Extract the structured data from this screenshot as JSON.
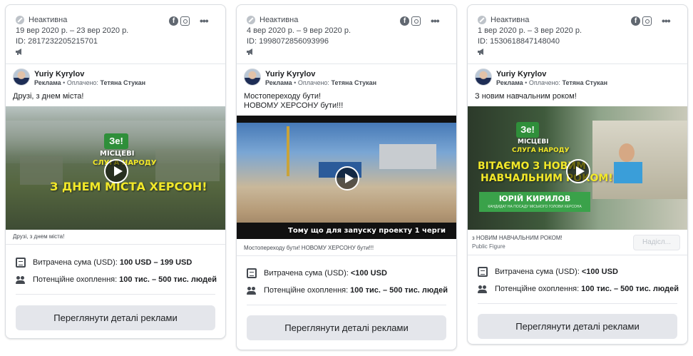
{
  "cards": [
    {
      "status": "Неактивна",
      "dates": "19 вер 2020 р. – 23 вер 2020 р.",
      "id": "ID: 2817232205215701",
      "page_name": "Yuriy Kyrylov",
      "sponsor_prefix": "Реклама",
      "sponsor_paid": " • Оплачено: ",
      "sponsor_payer": "Тетяна Стукан",
      "ad_text": "Друзі, з днем міста!",
      "media_caption": "Друзі, з днем міста!",
      "media_caption_sub": "",
      "thumb": {
        "logo": "Зе!",
        "line1": "МІСЦЕВІ",
        "line2": "СЛУГА НАРОДУ",
        "headline": "З ДНЕМ МІСТА ХЕРСОН!"
      },
      "spend_label": "Витрачена сума (USD):",
      "spend_value": "100 USD – 199 USD",
      "reach_label": "Потенційне охоплення:",
      "reach_value": "100 тис. – 500 тис. людей",
      "details_button": "Переглянути деталі реклами"
    },
    {
      "status": "Неактивна",
      "dates": "4 вер 2020 р. – 9 вер 2020 р.",
      "id": "ID: 1998072856093996",
      "page_name": "Yuriy Kyrylov",
      "sponsor_prefix": "Реклама",
      "sponsor_paid": " • Оплачено: ",
      "sponsor_payer": "Тетяна Стукан",
      "ad_text": "Мостопереходу бути!\nНОВОМУ ХЕРСОНУ бути!!!",
      "media_caption": "Мостопереходу бути! НОВОМУ ХЕРСОНУ бути!!!",
      "media_caption_sub": "",
      "thumb": {
        "subtitle": "Тому що для запуску проекту 1 черги"
      },
      "spend_label": "Витрачена сума (USD):",
      "spend_value": "<100 USD",
      "reach_label": "Потенційне охоплення:",
      "reach_value": "100 тис. – 500 тис. людей",
      "details_button": "Переглянути деталі реклами"
    },
    {
      "status": "Неактивна",
      "dates": "1 вер 2020 р. – 3 вер 2020 р.",
      "id": "ID: 1530618847148040",
      "page_name": "Yuriy Kyrylov",
      "sponsor_prefix": "Реклама",
      "sponsor_paid": " • Оплачено: ",
      "sponsor_payer": "Тетяна Стукан",
      "ad_text": "З новим навчальним роком!",
      "media_caption": "з НОВИМ НАВЧАЛЬНИМ РОКОМ!",
      "media_caption_sub": "Public Figure",
      "send_button": "Надісл...",
      "thumb": {
        "logo": "Зе!",
        "line1": "МІСЦЕВІ",
        "line2": "СЛУГА НАРОДУ",
        "headline1": "ВІТАЄМО З НОВИМ",
        "headline2": "НАВЧАЛЬНИМ РОКОМ!",
        "banner_name": "ЮРІЙ КИРИЛОВ",
        "banner_sub": "КАНДИДАТ НА ПОСАДУ МІСЬКОГО ГОЛОВИ ХЕРСОНА"
      },
      "spend_label": "Витрачена сума (USD):",
      "spend_value": "<100 USD",
      "reach_label": "Потенційне охоплення:",
      "reach_value": "100 тис. – 500 тис. людей",
      "details_button": "Переглянути деталі реклами"
    }
  ],
  "icons": {
    "status": "inactive-circle-icon",
    "facebook": "facebook-icon",
    "instagram": "instagram-icon",
    "more": "more-options-icon",
    "megaphone": "megaphone-icon",
    "spend": "document-icon",
    "reach": "people-icon",
    "play": "play-icon"
  }
}
